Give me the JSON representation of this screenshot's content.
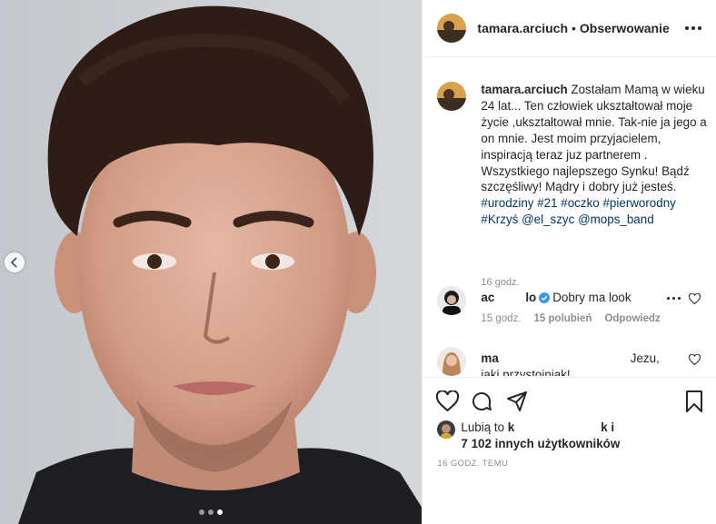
{
  "header": {
    "username": "tamara.arciuch",
    "separator": "•",
    "follow_label": "Obserwowanie",
    "more_icon": "more-horizontal-icon"
  },
  "media": {
    "carousel_dots": 3,
    "active_dot": 2,
    "prev_icon": "chevron-left-icon"
  },
  "caption": {
    "username": "tamara.arciuch",
    "text": " Zostałam Mamą w wieku 24 lat... Ten człowiek ukształtował moje życie ,ukształtował mnie. Tak-nie ja jego a on mnie. Jest moim przyjacielem, inspiracją teraz juz partnerem . Wszystkiego najlepszego Synku! Bądź szczęśliwy! Mądry i dobry już jesteś. ",
    "tags": [
      "#urodziny",
      "#21",
      "#oczko",
      "#pierworodny",
      "#Krzyś",
      "@el_szyc",
      "@mops_band"
    ],
    "time": "16 godz."
  },
  "comments": [
    {
      "user_start": "ac",
      "user_end": "lo",
      "verified": true,
      "text": "Dobry ma look",
      "time": "15 godz.",
      "likes": "15 polubień",
      "reply": "Odpowiedz"
    },
    {
      "user_start": "ma",
      "text_end": "Jezu,",
      "text_line2": "jaki przystojniak!"
    }
  ],
  "actions": {
    "like_icon": "heart-icon",
    "comment_icon": "comment-icon",
    "share_icon": "share-icon",
    "save_icon": "bookmark-icon"
  },
  "likes": {
    "prefix": "Lubią to",
    "name_start": "k",
    "name_end": "k i",
    "others": "7 102 innych użytkowników"
  },
  "timestamp": "16 GODZ. TEMU"
}
